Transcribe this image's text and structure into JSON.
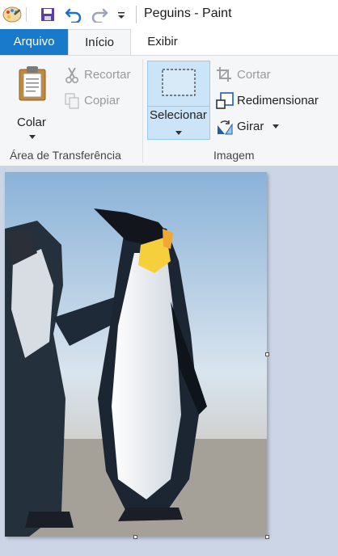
{
  "window": {
    "title": "Peguins - Paint"
  },
  "quick_access": {
    "app_icon": "paint-palette-icon",
    "save_icon": "save-icon",
    "undo_icon": "undo-icon",
    "redo_icon": "redo-icon",
    "customize_icon": "customize-quick-access-icon"
  },
  "tabs": [
    {
      "label": "Arquivo",
      "active": false
    },
    {
      "label": "Início",
      "active": true
    },
    {
      "label": "Exibir",
      "active": false
    }
  ],
  "ribbon": {
    "clipboard": {
      "group_label": "Área de Transferência",
      "paste_label": "Colar",
      "cut_label": "Recortar",
      "copy_label": "Copiar"
    },
    "image": {
      "group_label": "Imagem",
      "select_label": "Selecionar",
      "crop_label": "Cortar",
      "resize_label": "Redimensionar",
      "rotate_label": "Girar"
    }
  },
  "canvas": {
    "image_description_icon": "penguins-photo",
    "colors": {
      "accent": "#1979ca",
      "background": "#cbd5e6"
    }
  }
}
